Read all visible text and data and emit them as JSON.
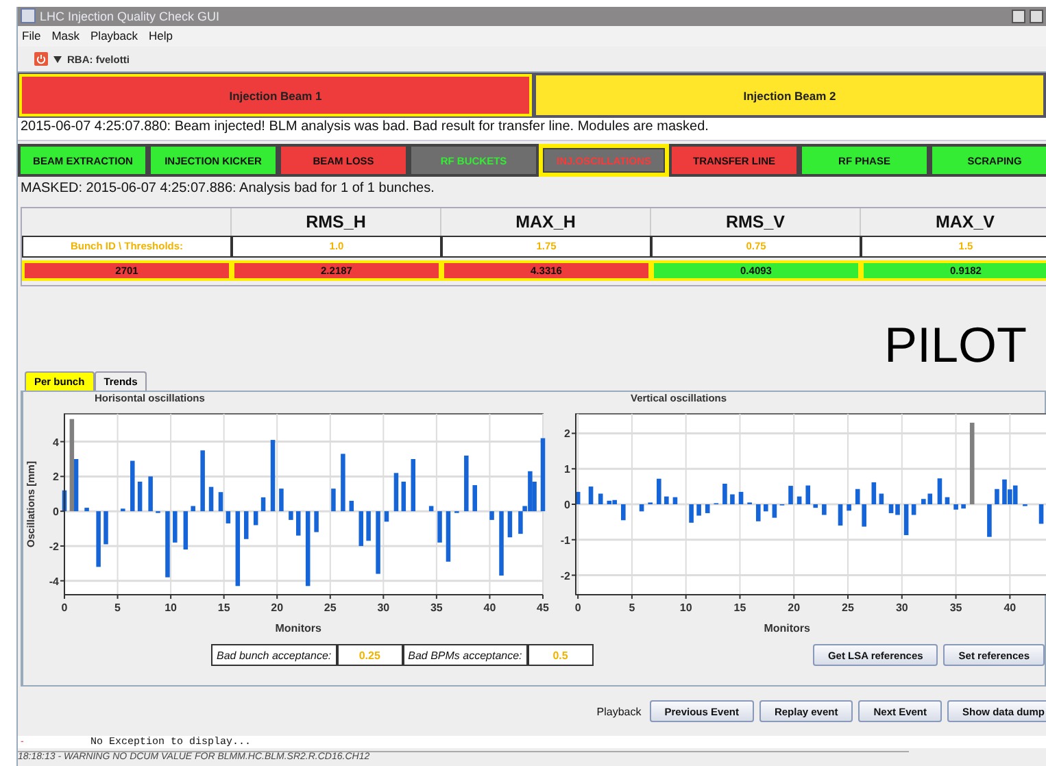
{
  "window": {
    "title": "LHC Injection Quality Check GUI"
  },
  "menu": [
    "File",
    "Mask",
    "Playback",
    "Help"
  ],
  "toolbar": {
    "user": "RBA: fvelotti"
  },
  "beams": [
    {
      "label": "Injection Beam 1",
      "color": "#ee3b3b",
      "selected": true
    },
    {
      "label": "Injection Beam 2",
      "color": "#ffe62b",
      "selected": false
    }
  ],
  "message": "2015-06-07 4:25:07.880: Beam injected! BLM analysis was bad. Bad result for transfer line. Modules are masked.",
  "modules": [
    {
      "label": "BEAM EXTRACTION",
      "color": "#35ec35",
      "masked": false,
      "selected": false
    },
    {
      "label": "INJECTION KICKER",
      "color": "#35ec35",
      "masked": false,
      "selected": false
    },
    {
      "label": "BEAM LOSS",
      "color": "#ee3b3b",
      "masked": false,
      "selected": false
    },
    {
      "label": "RF BUCKETS",
      "color": "#35ec35",
      "masked": true,
      "selected": false
    },
    {
      "label": "INJ.OSCILLATIONS",
      "color": "#ff3838",
      "masked": true,
      "selected": true
    },
    {
      "label": "TRANSFER LINE",
      "color": "#ee3b3b",
      "masked": false,
      "selected": false
    },
    {
      "label": "RF PHASE",
      "color": "#35ec35",
      "masked": false,
      "selected": false
    },
    {
      "label": "SCRAPING",
      "color": "#35ec35",
      "masked": false,
      "selected": false
    }
  ],
  "masked_message": "MASKED: 2015-06-07 4:25:07.886: Analysis bad for 1 of 1 bunches.",
  "table": {
    "columns": [
      "",
      "RMS_H",
      "MAX_H",
      "RMS_V",
      "MAX_V"
    ],
    "thresholds": {
      "label": "Bunch ID \\ Thresholds:",
      "values": [
        "1.0",
        "1.75",
        "0.75",
        "1.5"
      ]
    },
    "rows": [
      {
        "selected": true,
        "cells": [
          {
            "text": "2701",
            "color": "#ee3b3b"
          },
          {
            "text": "2.2187",
            "color": "#ee3b3b"
          },
          {
            "text": "4.3316",
            "color": "#ee3b3b"
          },
          {
            "text": "0.4093",
            "color": "#35ec35"
          },
          {
            "text": "0.9182",
            "color": "#35ec35"
          }
        ]
      }
    ]
  },
  "overlay_text": "PILOT",
  "tabs": [
    {
      "label": "Per bunch",
      "selected": true
    },
    {
      "label": "Trends",
      "selected": false
    }
  ],
  "charts": [
    {
      "chart_data": {
        "type": "bar",
        "grid": true,
        "title": "Horisontal oscillations",
        "xlabel": "Monitors",
        "ylabel": "Oscillations [mm]",
        "xlim": [
          0,
          45
        ],
        "ylim": [
          -4.8,
          5.6
        ],
        "xticks": [
          0,
          5,
          10,
          15,
          20,
          25,
          30,
          35,
          40,
          45
        ],
        "yticks": [
          -4,
          -2,
          0,
          2,
          4
        ],
        "x": [
          0,
          0.7,
          1.1,
          2.1,
          3.2,
          3.9,
          5.5,
          6.4,
          7.1,
          8.1,
          8.8,
          9.7,
          10.4,
          11.4,
          12.1,
          13,
          13.8,
          14.7,
          15.4,
          16.3,
          17.1,
          18,
          18.7,
          19.6,
          20.4,
          21.3,
          22,
          22.9,
          23.7,
          25.3,
          26.2,
          27,
          27.9,
          28.6,
          29.5,
          30.3,
          31.2,
          31.9,
          32.8,
          34.5,
          35.3,
          36.1,
          36.9,
          37.8,
          38.6,
          40.2,
          41.1,
          41.9,
          42.9,
          43.3,
          43.8,
          44.2,
          45
        ],
        "series": [
          {
            "color": "#1565d8",
            "values": [
              1.2,
              null,
              3.0,
              0.2,
              -3.2,
              -1.9,
              0.15,
              2.9,
              1.7,
              2.0,
              -0.1,
              -3.8,
              -1.8,
              -2.2,
              0.3,
              3.5,
              1.4,
              1.1,
              -0.7,
              -4.3,
              -1.6,
              -0.8,
              0.8,
              4.1,
              1.3,
              -0.5,
              -1.4,
              -4.3,
              -1.2,
              1.3,
              3.3,
              0.6,
              -2.0,
              -1.7,
              -3.6,
              -0.6,
              2.2,
              1.7,
              3.0,
              0.3,
              -1.8,
              -2.9,
              -0.1,
              3.2,
              1.5,
              -0.5,
              -3.7,
              -1.5,
              -1.3,
              0.3,
              2.3,
              1.7,
              4.2
            ]
          },
          {
            "color": "#808080",
            "values": [
              null,
              5.3,
              null,
              null,
              null,
              null,
              null,
              null,
              null,
              null,
              null,
              null,
              null,
              null,
              null,
              null,
              null,
              null,
              null,
              null,
              null,
              null,
              null,
              null,
              null,
              null,
              null,
              null,
              null,
              null,
              null,
              null,
              null,
              null,
              null,
              null,
              null,
              null,
              null,
              null,
              null,
              null,
              null,
              null,
              null,
              null,
              null,
              null,
              null,
              null,
              null,
              null,
              null
            ]
          }
        ]
      }
    },
    {
      "chart_data": {
        "type": "bar",
        "grid": true,
        "title": "Vertical oscillations",
        "xlabel": "Monitors",
        "xlim": [
          -0.2,
          45.5
        ],
        "ylim": [
          -2.55,
          2.55
        ],
        "xticks": [
          0,
          5,
          10,
          15,
          20,
          25,
          30,
          35,
          40
        ],
        "yticks": [
          -2,
          -1,
          0,
          1,
          2
        ],
        "x": [
          0,
          1.2,
          2.1,
          2.9,
          3.4,
          4.2,
          5.9,
          6.7,
          7.5,
          8.2,
          9,
          10.5,
          11.2,
          12,
          12.8,
          13.6,
          14.3,
          15.1,
          15.9,
          16.7,
          17.4,
          18.2,
          18.9,
          19.7,
          20.5,
          21.3,
          22,
          22.8,
          24.3,
          25.1,
          25.9,
          26.5,
          27.4,
          28.1,
          29,
          29.6,
          30.4,
          31.1,
          32,
          32.6,
          33.5,
          34.2,
          35,
          35.7,
          36.5,
          38.1,
          38.8,
          39.5,
          40,
          40.5,
          41.4,
          42.9
        ],
        "series": [
          {
            "color": "#1565d8",
            "values": [
              0.35,
              0.5,
              0.3,
              0.1,
              0.12,
              -0.45,
              -0.2,
              0.05,
              0.72,
              0.22,
              0.2,
              -0.52,
              -0.32,
              -0.25,
              0.03,
              0.58,
              0.28,
              0.35,
              0.05,
              -0.48,
              -0.2,
              -0.38,
              -0.03,
              0.52,
              0.22,
              0.53,
              -0.1,
              -0.3,
              -0.6,
              -0.18,
              0.43,
              -0.63,
              0.62,
              0.3,
              -0.25,
              -0.3,
              -0.87,
              -0.3,
              0.15,
              0.3,
              0.73,
              0.2,
              -0.15,
              -0.12,
              null,
              -0.92,
              0.43,
              0.7,
              0.42,
              0.53,
              -0.05,
              -0.55
            ]
          },
          {
            "color": "#808080",
            "values": [
              null,
              null,
              null,
              null,
              null,
              null,
              null,
              null,
              null,
              null,
              null,
              null,
              null,
              null,
              null,
              null,
              null,
              null,
              null,
              null,
              null,
              null,
              null,
              null,
              null,
              null,
              null,
              null,
              null,
              null,
              null,
              null,
              null,
              null,
              null,
              null,
              null,
              null,
              null,
              null,
              null,
              null,
              null,
              null,
              2.3,
              null,
              null,
              null,
              null,
              null,
              null,
              null
            ]
          }
        ]
      }
    }
  ],
  "acceptance": [
    {
      "label": "Bad bunch acceptance:",
      "value": "0.25"
    },
    {
      "label": "Bad BPMs acceptance:",
      "value": "0.5"
    }
  ],
  "reference_buttons": [
    "Get LSA references",
    "Set references"
  ],
  "playback": {
    "label": "Playback",
    "buttons": [
      "Previous Event",
      "Replay event",
      "Next Event",
      "Show data dump"
    ]
  },
  "exception": {
    "marker": "-",
    "text": "No Exception to display..."
  },
  "status_bar": "18:18:13 - WARNING NO DCUM VALUE FOR BLMM.HC.BLM.SR2.R.CD16.CH12"
}
